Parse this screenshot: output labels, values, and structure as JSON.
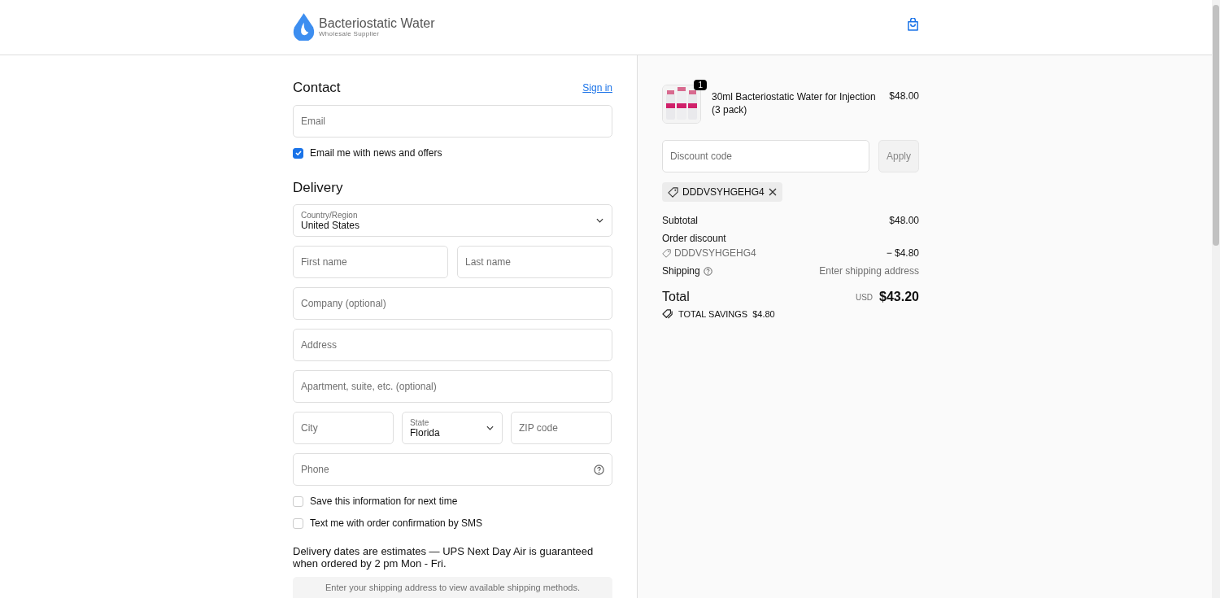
{
  "header": {
    "brand": "Bacteriostatic Water",
    "tagline": "Wholesale Supplier"
  },
  "contact": {
    "title": "Contact",
    "sign_in": "Sign in",
    "email": {
      "placeholder": "Email"
    },
    "news": {
      "label": "Email me with news and offers",
      "checked": true
    }
  },
  "delivery": {
    "title": "Delivery",
    "country": {
      "label": "Country/Region",
      "value": "United States"
    },
    "first_name": {
      "placeholder": "First name"
    },
    "last_name": {
      "placeholder": "Last name"
    },
    "company": {
      "placeholder": "Company (optional)"
    },
    "address": {
      "placeholder": "Address"
    },
    "apartment": {
      "placeholder": "Apartment, suite, etc. (optional)"
    },
    "city": {
      "placeholder": "City"
    },
    "state": {
      "label": "State",
      "value": "Florida"
    },
    "zip": {
      "placeholder": "ZIP code"
    },
    "phone": {
      "placeholder": "Phone"
    },
    "options": [
      {
        "label": "Save this information for next time",
        "checked": false
      },
      {
        "label": "Text me with order confirmation by SMS",
        "checked": false
      }
    ],
    "note": "Delivery dates are estimates — UPS Next Day Air is guaranteed when ordered by 2 pm Mon - Fri.",
    "shipping_notice": "Enter your shipping address to view available shipping methods."
  },
  "summary": {
    "item": {
      "quantity": "1",
      "name": "30ml Bacteriostatic Water for Injection (3 pack)",
      "price": "$48.00"
    },
    "discount": {
      "placeholder": "Discount code",
      "apply": "Apply",
      "applied_code": "DDDVSYHGEHG4"
    },
    "subtotal": {
      "label": "Subtotal",
      "value": "$48.00"
    },
    "order_discount": {
      "label": "Order discount",
      "code": "DDDVSYHGEHG4",
      "value": "− $4.80"
    },
    "shipping": {
      "label": "Shipping",
      "value": "Enter shipping address"
    },
    "total": {
      "label": "Total",
      "currency": "USD",
      "value": "$43.20"
    },
    "savings": {
      "label": "TOTAL SAVINGS",
      "value": "$4.80"
    }
  }
}
